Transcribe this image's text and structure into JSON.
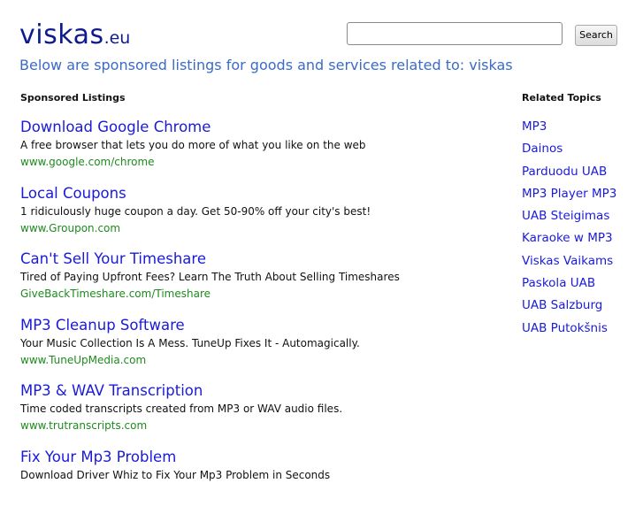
{
  "header": {
    "logo_main": "viskas",
    "logo_tld": ".eu",
    "search_value": "",
    "search_button_label": "Search",
    "subtitle": "Below are sponsored listings for goods and services related to: viskas"
  },
  "sponsored": {
    "heading": "Sponsored Listings",
    "listings": [
      {
        "title": "Download Google Chrome",
        "description": "A free browser that lets you do more of what you like on the web",
        "url": "www.google.com/chrome"
      },
      {
        "title": "Local Coupons",
        "description": "1 ridiculously huge coupon a day. Get 50-90% off your city's best!",
        "url": "www.Groupon.com"
      },
      {
        "title": "Can't Sell Your Timeshare",
        "description": "Tired of Paying Upfront Fees? Learn The Truth About Selling Timeshares",
        "url": "GiveBackTimeshare.com/Timeshare"
      },
      {
        "title": "MP3 Cleanup Software",
        "description": "Your Music Collection Is A Mess. TuneUp Fixes It - Automagically.",
        "url": "www.TuneUpMedia.com"
      },
      {
        "title": "MP3 & WAV Transcription",
        "description": "Time coded transcripts created from MP3 or WAV audio files.",
        "url": "www.trutranscripts.com"
      },
      {
        "title": "Fix Your Mp3 Problem",
        "description": "Download Driver Whiz to Fix Your Mp3 Problem in Seconds",
        "url": ""
      }
    ]
  },
  "related": {
    "heading": "Related Topics",
    "items": [
      "MP3",
      "Dainos",
      "Parduodu UAB",
      "MP3 Player MP3",
      "UAB Steigimas",
      "Karaoke w MP3",
      "Viskas Vaikams",
      "Paskola UAB",
      "UAB Salzburg",
      "UAB Putokšnis"
    ]
  },
  "colors": {
    "logo": "#0e1b8f",
    "subtitle": "#3a6bc6",
    "link": "#1a1adb",
    "url": "#1e8a1e"
  }
}
